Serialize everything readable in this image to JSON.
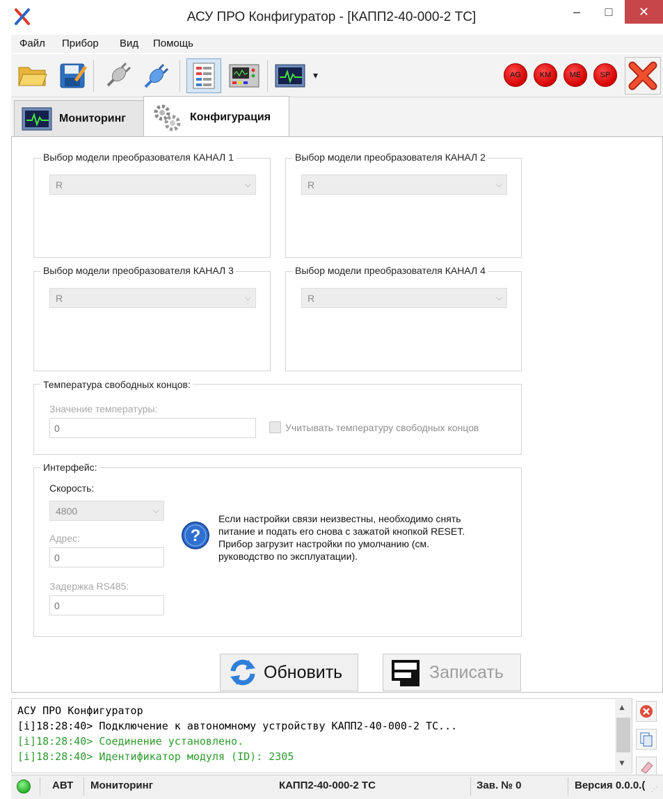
{
  "window": {
    "title": "АСУ ПРО Конфигуратор - [КАПП2-40-000-2 ТС]",
    "min_glyph": "–",
    "max_glyph": "□",
    "close_glyph": "✕"
  },
  "menu": [
    "Файл",
    "Прибор",
    "Вид",
    "Помощь"
  ],
  "toolbar": {
    "buttons": [
      "open-folder-icon",
      "save-icon",
      "disconnect-icon",
      "connect-icon",
      "config-view-icon",
      "device-panel-icon",
      "monitor-chart-icon"
    ],
    "dropdown_glyph": "▾",
    "flags": [
      "AG",
      "KM",
      "ME",
      "SP"
    ],
    "active_button": "config-view-icon"
  },
  "tabs": [
    {
      "label": "Мониторинг",
      "icon": "monitor-chart-icon",
      "active": false
    },
    {
      "label": "Конфигурация",
      "icon": "gears-icon",
      "active": true
    }
  ],
  "channels": [
    {
      "title": "Выбор модели преобразователя  КАНАЛ 1",
      "value": "R"
    },
    {
      "title": "Выбор модели преобразователя  КАНАЛ 2",
      "value": "R"
    },
    {
      "title": "Выбор модели преобразователя  КАНАЛ 3",
      "value": "R"
    },
    {
      "title": "Выбор модели преобразователя  КАНАЛ 4",
      "value": "R"
    }
  ],
  "cold_junction": {
    "title": "Температура свободных концов:",
    "value_label": "Значение температуры:",
    "value": "0",
    "checkbox_label": "Учитывать температуру свободных концов",
    "checked": false
  },
  "interface": {
    "title": "Интерфейс:",
    "speed_label": "Скорость:",
    "speed_value": "4800",
    "address_label": "Адрес:",
    "address_value": "0",
    "delay_label": "Задержка RS485:",
    "delay_value": "0",
    "help_text": [
      "Если настройки связи неизвестны, необходимо снять",
      "питание и подать его снова с зажатой кнопкой RESET.",
      "Прибор загрузит настройки по умолчанию (см.",
      "руководство по эксплуатации)."
    ]
  },
  "actions": {
    "refresh_label": "Обновить",
    "write_label": "Записать"
  },
  "log": {
    "lines": [
      {
        "text": "АСУ ПРО Конфигуратор",
        "color": "#000000"
      },
      {
        "text": "[i]18:28:40> Подключение к автономному устройству КАПП2-40-000-2 ТС...",
        "color": "#000000"
      },
      {
        "text": "[i]18:28:40> Соединение установлено.",
        "color": "#2e9a2e"
      },
      {
        "text": "[i]18:28:40> Идентификатор модуля (ID): 2305",
        "color": "#2e9a2e"
      }
    ]
  },
  "status": {
    "mode": "АВТ",
    "view": "Мониторинг",
    "device": "КАПП2-40-000-2 ТС",
    "serial": "Зав. № 0",
    "version": "Версия 0.0.0.("
  },
  "colors": {
    "accent_red": "#d40000",
    "status_green": "#33cc33",
    "log_green": "#2e9a2e"
  }
}
